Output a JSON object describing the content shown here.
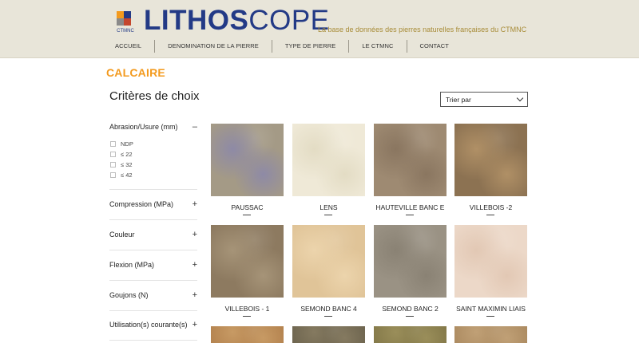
{
  "header": {
    "logo_word_bold": "LITHOS",
    "logo_word_light": "COPE",
    "logo_mark_text": "CTMNC",
    "tagline": "La base de données des pierres naturelles françaises du CTMNC",
    "nav": [
      "ACCUEIL",
      "DENOMINATION DE LA PIERRE",
      "TYPE DE PIERRE",
      "LE CTMNC",
      "CONTACT"
    ],
    "colors": {
      "background": "#e8e5d9",
      "logo": "#233a86",
      "tagline": "#a88c38"
    }
  },
  "category": {
    "title": "CALCAIRE",
    "color": "#f39a1e"
  },
  "sidebar": {
    "title": "Critères de choix",
    "filters": [
      {
        "label": "Abrasion/Usure (mm)",
        "toggle": "–",
        "expanded": true,
        "options": [
          "NDP",
          "≤ 22",
          "≤ 32",
          "≤ 42"
        ]
      },
      {
        "label": "Compression (MPa)",
        "toggle": "+"
      },
      {
        "label": "Couleur",
        "toggle": "+"
      },
      {
        "label": "Flexion (MPa)",
        "toggle": "+"
      },
      {
        "label": "Goujons (N)",
        "toggle": "+"
      },
      {
        "label": "Utilisation(s) courante(s)",
        "toggle": "+"
      }
    ]
  },
  "sort": {
    "label": "Trier par",
    "icon": "chevron-down-icon"
  },
  "stones": [
    {
      "name": "PAUSSAC",
      "color": "#a49a86",
      "accent": "#8e8aa6"
    },
    {
      "name": "LENS",
      "color": "#efe9d7",
      "accent": "#e3dcc4"
    },
    {
      "name": "HAUTEVILLE BANC E",
      "color": "#9e8a72",
      "accent": "#8a7660"
    },
    {
      "name": "VILLEBOIS -2",
      "color": "#8c7252",
      "accent": "#b09066"
    },
    {
      "name": "VILLEBOIS - 1",
      "color": "#8d7a60",
      "accent": "#a69478"
    },
    {
      "name": "SEMOND BANC 4",
      "color": "#e0c498",
      "accent": "#ecd4ac"
    },
    {
      "name": "SEMOND BANC 2",
      "color": "#9a9284",
      "accent": "#8a8274"
    },
    {
      "name": "SAINT MAXIMIN LIAIS",
      "color": "#ecd8c8",
      "accent": "#e2c8b4"
    },
    {
      "name": "",
      "color": "#b58450",
      "accent": "#c79a64"
    },
    {
      "name": "",
      "color": "#6f6650",
      "accent": "#857a60"
    },
    {
      "name": "",
      "color": "#857a4a",
      "accent": "#9a8e5a"
    },
    {
      "name": "",
      "color": "#ad8c62",
      "accent": "#c0a076"
    }
  ]
}
